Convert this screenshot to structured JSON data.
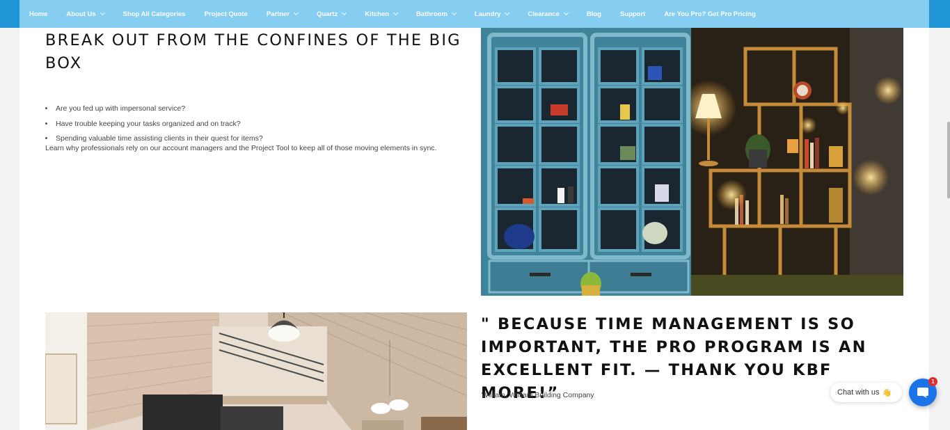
{
  "nav": {
    "items": [
      {
        "label": "Home",
        "dropdown": false
      },
      {
        "label": "About Us",
        "dropdown": true
      },
      {
        "label": "Shop All Categories",
        "dropdown": false
      },
      {
        "label": "Project Quote",
        "dropdown": false
      },
      {
        "label": "Partner",
        "dropdown": true
      },
      {
        "label": "Quartz",
        "dropdown": true
      },
      {
        "label": "Kitchen",
        "dropdown": true
      },
      {
        "label": "Bathroom",
        "dropdown": true
      },
      {
        "label": "Laundry",
        "dropdown": true
      },
      {
        "label": "Clearance",
        "dropdown": true
      },
      {
        "label": "Blog",
        "dropdown": false
      },
      {
        "label": "Support",
        "dropdown": false
      },
      {
        "label": "Are You Pro? Get Pro Pricing",
        "dropdown": false
      }
    ],
    "background": "#85cdf1",
    "edge_color": "#1f95d6"
  },
  "section1": {
    "heading": "BREAK OUT FROM THE CONFINES OF THE BIG BOX",
    "bullets": [
      "Are you fed up with impersonal service?",
      "Have trouble keeping your tasks organized and on track?",
      "Spending valuable time assisting clients in their quest for items?"
    ],
    "body": "Learn why professionals rely on our account managers and the Project Tool to keep all of those moving elements in sync."
  },
  "testimonial": {
    "quote": "\" BECAUSE TIME MANAGEMENT IS SO IMPORTANT, THE PRO PROGRAM IS AN EXCELLENT FIT. — THANK YOU KBF MORE!”",
    "attribution": "William, William Building Company"
  },
  "chat": {
    "label": "Chat with us",
    "emoji": "👋",
    "badge_count": "1",
    "button_color": "#1a73e8",
    "badge_color": "#e32b2b"
  }
}
